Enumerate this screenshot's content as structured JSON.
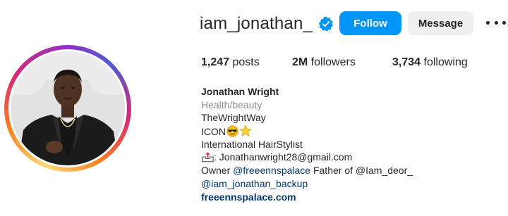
{
  "profile": {
    "username": "iam_jonathan_",
    "verified_icon": "verified-badge-icon",
    "follow_label": "Follow",
    "message_label": "Message",
    "more_icon": "more-options-icon"
  },
  "stats": {
    "posts_count": "1,247",
    "posts_label": " posts",
    "followers_count": "2M",
    "followers_label": " followers",
    "following_count": "3,734",
    "following_label": " following"
  },
  "bio": {
    "name": "Jonathan Wright",
    "category": "Health/beauty",
    "line1": "TheWrightWay",
    "line2": "ICON",
    "line2_icons": [
      "sunglasses-face-icon",
      "star-icon"
    ],
    "line3": "International HairStylist",
    "email_icon": "outbox-tray-icon",
    "email_text": ": Jonathanwright28@gmail.com",
    "owner_prefix": "Owner ",
    "owner_mention": "@freeennspalace",
    "father_prefix": " Father of ",
    "father_mention": "@Iam_deor_",
    "backup_mention": "@iam_jonathan_backup",
    "website": "freeennspalace.com"
  },
  "colors": {
    "follow_button": "#0095f6",
    "message_button": "#efefef",
    "verified_badge": "#0095f6",
    "mention_link": "#00376b",
    "category_text": "#8e8e8e"
  }
}
